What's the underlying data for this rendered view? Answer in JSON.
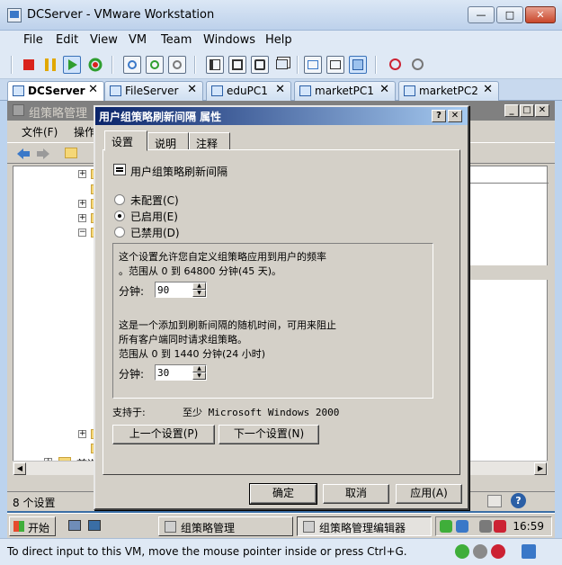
{
  "app": {
    "title": "DCServer - VMware Workstation",
    "menu": [
      "File",
      "Edit",
      "View",
      "VM",
      "Team",
      "Windows",
      "Help"
    ],
    "tabs": [
      {
        "label": "DCServer",
        "active": true
      },
      {
        "label": "FileServer",
        "active": false
      },
      {
        "label": "eduPC1",
        "active": false
      },
      {
        "label": "marketPC1",
        "active": false
      },
      {
        "label": "marketPC2",
        "active": false
      }
    ],
    "tab_close": "✕",
    "status": "To direct input to this VM, move the mouse pointer inside or press Ctrl+G.",
    "colors": {
      "titlebar": "#bdd1eb",
      "power_off": "#d9231c",
      "pause": "#e1a800",
      "play": "#2f9e2f"
    }
  },
  "gpme": {
    "title": "组策略管理",
    "menu": [
      "文件(F)",
      "操作"
    ],
    "tree_bottom_label": "首选",
    "status": "8 个设置"
  },
  "dialog": {
    "title": "用户组策略刷新间隔 属性",
    "help_btn": "?",
    "close_btn": "✕",
    "tabs": [
      "设置",
      "说明",
      "注释"
    ],
    "policy_name": "用户组策略刷新间隔",
    "radios": [
      {
        "label": "未配置(C)",
        "checked": false
      },
      {
        "label": "已启用(E)",
        "checked": true
      },
      {
        "label": "已禁用(D)",
        "checked": false
      }
    ],
    "options": {
      "line1": "这个设置允许您自定义组策略应用到用户的频率",
      "line2": "。范围从 0 到 64800 分钟(45 天)。",
      "minutes_label": "分钟:",
      "minutes_value": "90",
      "line3": "这是一个添加到刷新间隔的随机时间，可用来阻止",
      "line4": "所有客户端同时请求组策略。",
      "line5": "范围从 0 到 1440 分钟(24 小时)",
      "offset_label": "分钟:",
      "offset_value": "30"
    },
    "supported_label": "支持于:",
    "supported_value": "至少 Microsoft Windows 2000",
    "prev_btn": "上一个设置(P)",
    "next_btn": "下一个设置(N)",
    "ok_btn": "确定",
    "cancel_btn": "取消",
    "apply_btn": "应用(A)"
  },
  "taskbar": {
    "start": "开始",
    "tasks": [
      {
        "label": "组策略管理",
        "pressed": false
      },
      {
        "label": "组策略管理编辑器",
        "pressed": true
      }
    ],
    "clock": "16:59"
  },
  "gpme_caption": {
    "minimize": "_",
    "restore": "□",
    "close": "✕"
  },
  "icons": [
    "vm-logo-icon",
    "power-off-icon",
    "pause-icon",
    "play-icon",
    "reset-icon",
    "snapshot-icon",
    "back-icon",
    "forward-icon",
    "folder-icon",
    "policy-icon",
    "help-icon",
    "volume-icon",
    "network-icon"
  ]
}
